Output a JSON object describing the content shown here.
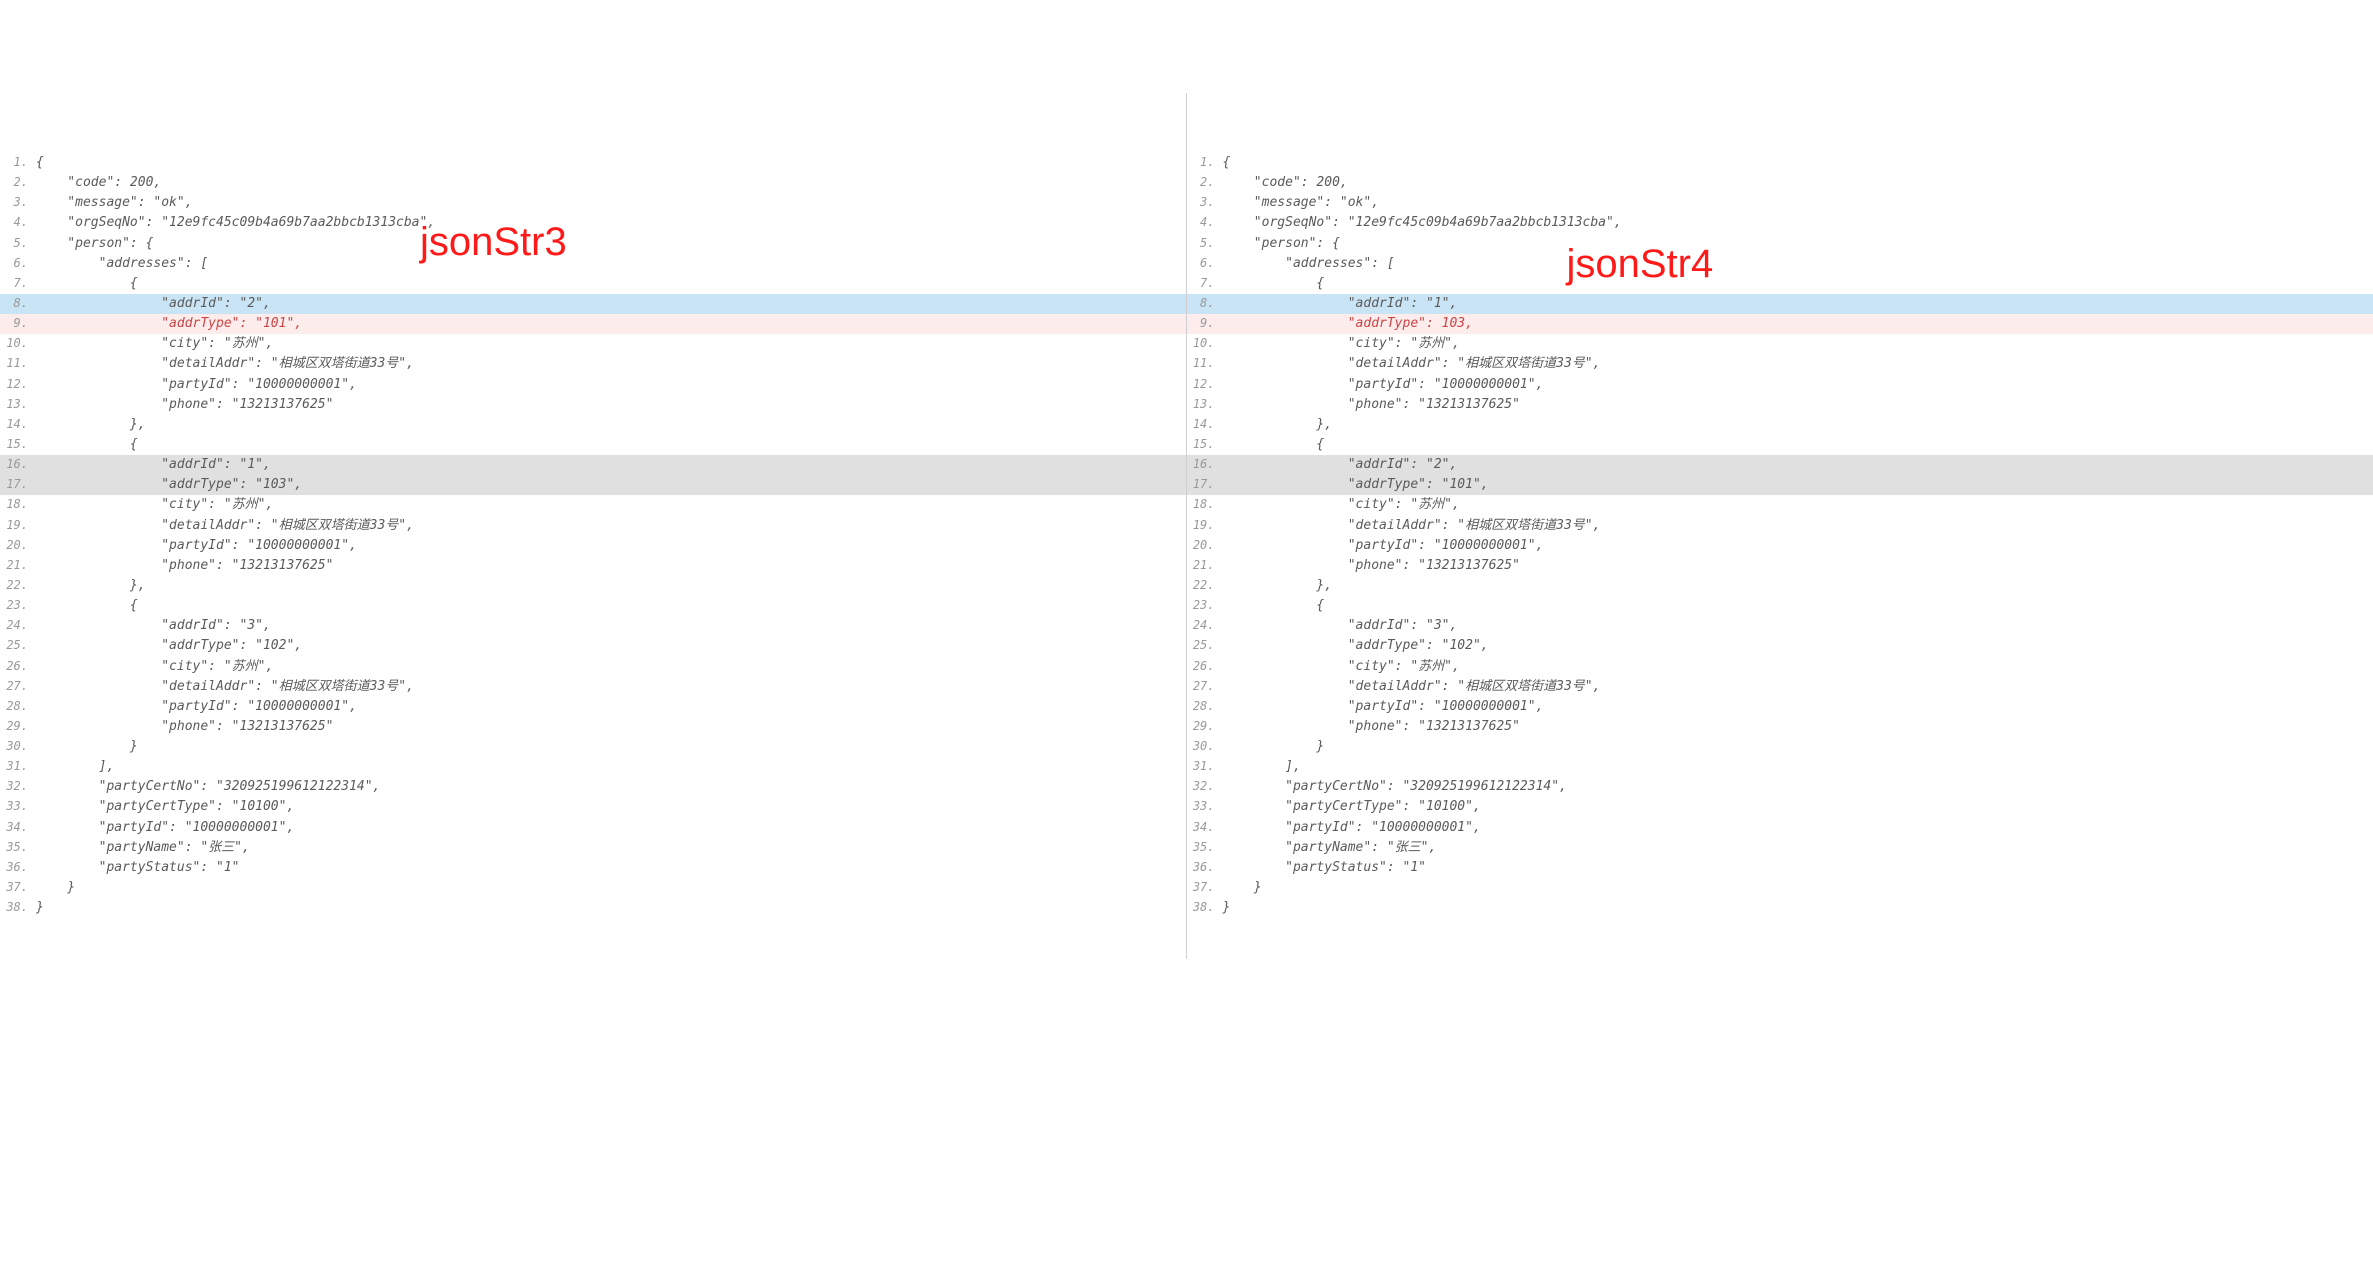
{
  "labels": {
    "left": "jsonStr3",
    "right": "jsonStr4"
  },
  "left": {
    "lines": [
      {
        "n": "1.",
        "t": "{"
      },
      {
        "n": "2.",
        "t": "    \"code\": 200,"
      },
      {
        "n": "3.",
        "t": "    \"message\": \"ok\","
      },
      {
        "n": "4.",
        "t": "    \"orgSeqNo\": \"12e9fc45c09b4a69b7aa2bbcb1313cba\","
      },
      {
        "n": "5.",
        "t": "    \"person\": {"
      },
      {
        "n": "6.",
        "t": "        \"addresses\": ["
      },
      {
        "n": "7.",
        "t": "            {"
      },
      {
        "n": "8.",
        "t": "                \"addrId\": \"2\",",
        "hl": "blue"
      },
      {
        "n": "9.",
        "t": "                \"addrType\": \"101\",",
        "hl": "pink",
        "fg": "red"
      },
      {
        "n": "10.",
        "t": "                \"city\": \"苏州\","
      },
      {
        "n": "11.",
        "t": "                \"detailAddr\": \"相城区双塔街道33号\","
      },
      {
        "n": "12.",
        "t": "                \"partyId\": \"10000000001\","
      },
      {
        "n": "13.",
        "t": "                \"phone\": \"13213137625\""
      },
      {
        "n": "14.",
        "t": "            },"
      },
      {
        "n": "15.",
        "t": "            {"
      },
      {
        "n": "16.",
        "t": "                \"addrId\": \"1\",",
        "hl": "grey"
      },
      {
        "n": "17.",
        "t": "                \"addrType\": \"103\",",
        "hl": "grey"
      },
      {
        "n": "18.",
        "t": "                \"city\": \"苏州\","
      },
      {
        "n": "19.",
        "t": "                \"detailAddr\": \"相城区双塔街道33号\","
      },
      {
        "n": "20.",
        "t": "                \"partyId\": \"10000000001\","
      },
      {
        "n": "21.",
        "t": "                \"phone\": \"13213137625\""
      },
      {
        "n": "22.",
        "t": "            },"
      },
      {
        "n": "23.",
        "t": "            {"
      },
      {
        "n": "24.",
        "t": "                \"addrId\": \"3\","
      },
      {
        "n": "25.",
        "t": "                \"addrType\": \"102\","
      },
      {
        "n": "26.",
        "t": "                \"city\": \"苏州\","
      },
      {
        "n": "27.",
        "t": "                \"detailAddr\": \"相城区双塔街道33号\","
      },
      {
        "n": "28.",
        "t": "                \"partyId\": \"10000000001\","
      },
      {
        "n": "29.",
        "t": "                \"phone\": \"13213137625\""
      },
      {
        "n": "30.",
        "t": "            }"
      },
      {
        "n": "31.",
        "t": "        ],"
      },
      {
        "n": "32.",
        "t": "        \"partyCertNo\": \"320925199612122314\","
      },
      {
        "n": "33.",
        "t": "        \"partyCertType\": \"10100\","
      },
      {
        "n": "34.",
        "t": "        \"partyId\": \"10000000001\","
      },
      {
        "n": "35.",
        "t": "        \"partyName\": \"张三\","
      },
      {
        "n": "36.",
        "t": "        \"partyStatus\": \"1\""
      },
      {
        "n": "37.",
        "t": "    }"
      },
      {
        "n": "38.",
        "t": "}"
      }
    ]
  },
  "right": {
    "lines": [
      {
        "n": "1.",
        "t": "{"
      },
      {
        "n": "2.",
        "t": "    \"code\": 200,"
      },
      {
        "n": "3.",
        "t": "    \"message\": \"ok\","
      },
      {
        "n": "4.",
        "t": "    \"orgSeqNo\": \"12e9fc45c09b4a69b7aa2bbcb1313cba\","
      },
      {
        "n": "5.",
        "t": "    \"person\": {"
      },
      {
        "n": "6.",
        "t": "        \"addresses\": ["
      },
      {
        "n": "7.",
        "t": "            {"
      },
      {
        "n": "8.",
        "t": "                \"addrId\": \"1\",",
        "hl": "blue"
      },
      {
        "n": "9.",
        "t": "                \"addrType\": 103,",
        "hl": "pink",
        "fg": "red"
      },
      {
        "n": "10.",
        "t": "                \"city\": \"苏州\","
      },
      {
        "n": "11.",
        "t": "                \"detailAddr\": \"相城区双塔街道33号\","
      },
      {
        "n": "12.",
        "t": "                \"partyId\": \"10000000001\","
      },
      {
        "n": "13.",
        "t": "                \"phone\": \"13213137625\""
      },
      {
        "n": "14.",
        "t": "            },"
      },
      {
        "n": "15.",
        "t": "            {"
      },
      {
        "n": "16.",
        "t": "                \"addrId\": \"2\",",
        "hl": "grey"
      },
      {
        "n": "17.",
        "t": "                \"addrType\": \"101\",",
        "hl": "grey"
      },
      {
        "n": "18.",
        "t": "                \"city\": \"苏州\","
      },
      {
        "n": "19.",
        "t": "                \"detailAddr\": \"相城区双塔街道33号\","
      },
      {
        "n": "20.",
        "t": "                \"partyId\": \"10000000001\","
      },
      {
        "n": "21.",
        "t": "                \"phone\": \"13213137625\""
      },
      {
        "n": "22.",
        "t": "            },"
      },
      {
        "n": "23.",
        "t": "            {"
      },
      {
        "n": "24.",
        "t": "                \"addrId\": \"3\","
      },
      {
        "n": "25.",
        "t": "                \"addrType\": \"102\","
      },
      {
        "n": "26.",
        "t": "                \"city\": \"苏州\","
      },
      {
        "n": "27.",
        "t": "                \"detailAddr\": \"相城区双塔街道33号\","
      },
      {
        "n": "28.",
        "t": "                \"partyId\": \"10000000001\","
      },
      {
        "n": "29.",
        "t": "                \"phone\": \"13213137625\""
      },
      {
        "n": "30.",
        "t": "            }"
      },
      {
        "n": "31.",
        "t": "        ],"
      },
      {
        "n": "32.",
        "t": "        \"partyCertNo\": \"320925199612122314\","
      },
      {
        "n": "33.",
        "t": "        \"partyCertType\": \"10100\","
      },
      {
        "n": "34.",
        "t": "        \"partyId\": \"10000000001\","
      },
      {
        "n": "35.",
        "t": "        \"partyName\": \"张三\","
      },
      {
        "n": "36.",
        "t": "        \"partyStatus\": \"1\""
      },
      {
        "n": "37.",
        "t": "    }"
      },
      {
        "n": "38.",
        "t": "}"
      }
    ]
  }
}
